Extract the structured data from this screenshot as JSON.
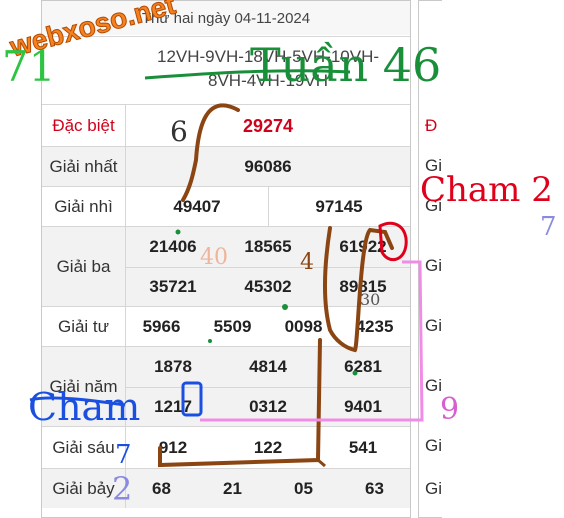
{
  "header": {
    "date": "Thứ hai ngày 04-11-2024",
    "codes_line1": "12VH-9VH-18VH-5VH-10VH-",
    "codes_line2": "8VH-4VH-19VH"
  },
  "logo": {
    "text": "webxoso.net"
  },
  "prizes": {
    "dac_biet": {
      "label": "Đặc biệt",
      "values": [
        "29274"
      ]
    },
    "nhat": {
      "label": "Giải nhất",
      "values": [
        "96086"
      ]
    },
    "nhi": {
      "label": "Giải nhì",
      "values": [
        "49407",
        "97145"
      ]
    },
    "ba": {
      "label": "Giải ba",
      "values": [
        "21406",
        "18565",
        "61922",
        "35721",
        "45302",
        "89815"
      ]
    },
    "tu": {
      "label": "Giải tư",
      "values": [
        "5966",
        "5509",
        "0098",
        "4235"
      ]
    },
    "nam": {
      "label": "Giải năm",
      "values": [
        "1878",
        "4814",
        "6281",
        "1217",
        "0312",
        "9401"
      ]
    },
    "sau": {
      "label": "Giải sáu",
      "values": [
        "912",
        "122",
        "541"
      ]
    },
    "bay": {
      "label": "Giải bảy",
      "values": [
        "68",
        "21",
        "05",
        "63"
      ]
    }
  },
  "right_table": {
    "labels": [
      "Đ",
      "Gi",
      "Gi",
      "Gi",
      "Gi",
      "Gi",
      "Gi",
      "Gi"
    ]
  },
  "annotations": {
    "tuan": "Tuần 46",
    "num_71": "71",
    "num_6": "6",
    "num_40": "40",
    "num_4": "4",
    "num_30": "30",
    "cham_right": "Cham 2",
    "cham_left": "Cham",
    "num_9": "9",
    "num_7a": "7",
    "num_7b": "7",
    "num_2": "2"
  },
  "colors": {
    "red": "#d0021b",
    "brown": "#8b4513",
    "pink": "#f08ce6",
    "green": "#1a8f3a",
    "blue": "#1a4fe0"
  }
}
